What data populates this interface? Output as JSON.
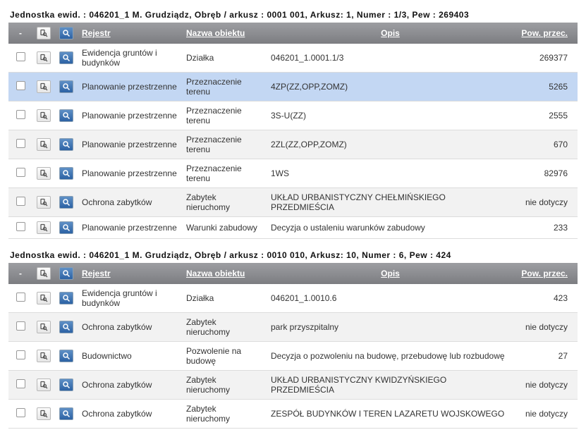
{
  "headers": {
    "dash": "-",
    "rejestr": "Rejestr",
    "nazwa": "Nazwa obiektu",
    "opis": "Opis",
    "pow": "Pow. przec."
  },
  "sections": [
    {
      "title": "Jednostka ewid. : 046201_1 M. Grudziądz, Obręb / arkusz : 0001 001, Arkusz: 1, Numer : 1/3, Pew : 269403",
      "rows": [
        {
          "rejestr": "Ewidencja gruntów i budynków",
          "nazwa": "Działka",
          "opis": "046201_1.0001.1/3",
          "pow": "269377",
          "selected": false
        },
        {
          "rejestr": "Planowanie przestrzenne",
          "nazwa": "Przeznaczenie terenu",
          "opis": "4ZP(ZZ,OPP,ZOMZ)",
          "pow": "5265",
          "selected": true
        },
        {
          "rejestr": "Planowanie przestrzenne",
          "nazwa": "Przeznaczenie terenu",
          "opis": "3S-U(ZZ)",
          "pow": "2555",
          "selected": false
        },
        {
          "rejestr": "Planowanie przestrzenne",
          "nazwa": "Przeznaczenie terenu",
          "opis": "2ZL(ZZ,OPP,ZOMZ)",
          "pow": "670",
          "selected": false
        },
        {
          "rejestr": "Planowanie przestrzenne",
          "nazwa": "Przeznaczenie terenu",
          "opis": "1WS",
          "pow": "82976",
          "selected": false
        },
        {
          "rejestr": "Ochrona zabytków",
          "nazwa": "Zabytek nieruchomy",
          "opis": "UKŁAD URBANISTYCZNY CHEŁMIŃSKIEGO PRZEDMIEŚCIA",
          "pow": "nie dotyczy",
          "selected": false
        },
        {
          "rejestr": "Planowanie przestrzenne",
          "nazwa": "Warunki zabudowy",
          "opis": "Decyzja o ustaleniu warunków zabudowy",
          "pow": "233",
          "selected": false
        }
      ]
    },
    {
      "title": "Jednostka ewid. : 046201_1 M. Grudziądz, Obręb / arkusz : 0010 010, Arkusz: 10, Numer : 6, Pew : 424",
      "rows": [
        {
          "rejestr": "Ewidencja gruntów i budynków",
          "nazwa": "Działka",
          "opis": "046201_1.0010.6",
          "pow": "423",
          "selected": false
        },
        {
          "rejestr": "Ochrona zabytków",
          "nazwa": "Zabytek nieruchomy",
          "opis": "park przyszpitalny",
          "pow": "nie dotyczy",
          "selected": false
        },
        {
          "rejestr": "Budownictwo",
          "nazwa": "Pozwolenie na budowę",
          "opis": "Decyzja o pozwoleniu na budowę, przebudowę lub rozbudowę",
          "pow": "27",
          "selected": false
        },
        {
          "rejestr": "Ochrona zabytków",
          "nazwa": "Zabytek nieruchomy",
          "opis": "UKŁAD URBANISTYCZNY KWIDZYŃSKIEGO PRZEDMIEŚCIA",
          "pow": "nie dotyczy",
          "selected": false
        },
        {
          "rejestr": "Ochrona zabytków",
          "nazwa": "Zabytek nieruchomy",
          "opis": "ZESPÓŁ BUDYNKÓW I TEREN LAZARETU WOJSKOWEGO",
          "pow": "nie dotyczy",
          "selected": false
        }
      ]
    }
  ]
}
